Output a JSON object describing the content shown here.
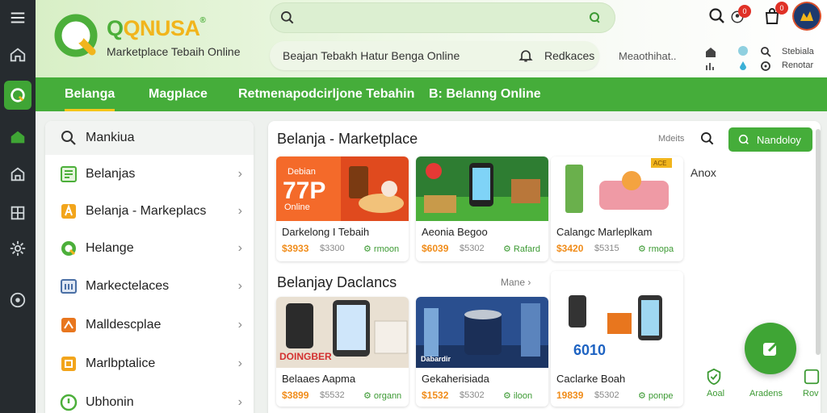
{
  "rail": {
    "icons": [
      "menu-icon",
      "home-icon",
      "brand-icon",
      "store-icon",
      "building-icon",
      "grid-icon",
      "settings-icon",
      "help-icon"
    ]
  },
  "header": {
    "brand": {
      "mark_letter": "Q",
      "name_q": "Q",
      "name_rest": "QNUSA",
      "name_mark": "®",
      "tagline": "Marketplace Tebaih Online"
    },
    "search": {
      "value": "",
      "placeholder": ""
    },
    "promo": {
      "text": "Beajan Tebakh Hatur Benga Online",
      "link": "Redkaces"
    },
    "link": "Meaothihat..",
    "cart_badge": "0",
    "bag_badge": "0",
    "mini": {
      "a_label": "Stebiala",
      "b_label": "Renotar"
    }
  },
  "nav": {
    "tabs": [
      "Belanga",
      "Magplace",
      "Retmenapodcirljone Tebahin",
      "B: Belanng Online"
    ],
    "active": 0
  },
  "sidebar": {
    "items": [
      {
        "label": "Mankiua",
        "icon": "search-icon",
        "color": "#555555"
      },
      {
        "label": "Belanjas",
        "icon": "document-icon",
        "color": "#4caf3a"
      },
      {
        "label": "Belanja - Markeplacs",
        "icon": "tag-icon",
        "color": "#f2a51c"
      },
      {
        "label": "Helange",
        "icon": "brand-q-icon",
        "color": "#4caf3a"
      },
      {
        "label": "Markectelaces",
        "icon": "store-icon",
        "color": "#4a6fa5"
      },
      {
        "label": "Malldescplae",
        "icon": "box-icon",
        "color": "#e8761e"
      },
      {
        "label": "Marlbptalice",
        "icon": "bag-icon",
        "color": "#f2a51c"
      },
      {
        "label": "Ubhonin",
        "icon": "chat-icon",
        "color": "#4caf3a"
      }
    ]
  },
  "main": {
    "title": "Belanja - Marketplace",
    "small_link": "Mdeits",
    "button_label": "Nandoloy",
    "section2_title": "Belanjay Daclancs",
    "more_label": "Mane ›",
    "right_heading": "Anox",
    "cards_row1": [
      {
        "title": "Darkelong I Tebaih",
        "price": "$3933",
        "old": "$3300",
        "seller": "rmoon",
        "promo_big": "77P",
        "promo_top": "Debian",
        "promo_bottom": "Online"
      },
      {
        "title": "Aeonia Begoo",
        "price": "$6039",
        "old": "$5302",
        "seller": "Rafard"
      },
      {
        "title": "Calangc Marleplkam",
        "price": "$3420",
        "old": "$5315",
        "seller": "rmopa",
        "tag": "ACE"
      }
    ],
    "cards_row2": [
      {
        "title": "Belaaes Aapma",
        "price": "$3899",
        "old": "$5532",
        "seller": "organn",
        "promo": "DOINGBER"
      },
      {
        "title": "Gekaherisiada",
        "price": "$1532",
        "old": "$5302",
        "seller": "iloon",
        "promo": "Dabardir"
      },
      {
        "title": "Caclarke Boah",
        "price": "19839",
        "old": "$5302",
        "seller": "ponpe",
        "promo": "6010"
      }
    ],
    "bottom_actions": [
      "Aoal",
      "Aradens",
      "Rov"
    ]
  }
}
